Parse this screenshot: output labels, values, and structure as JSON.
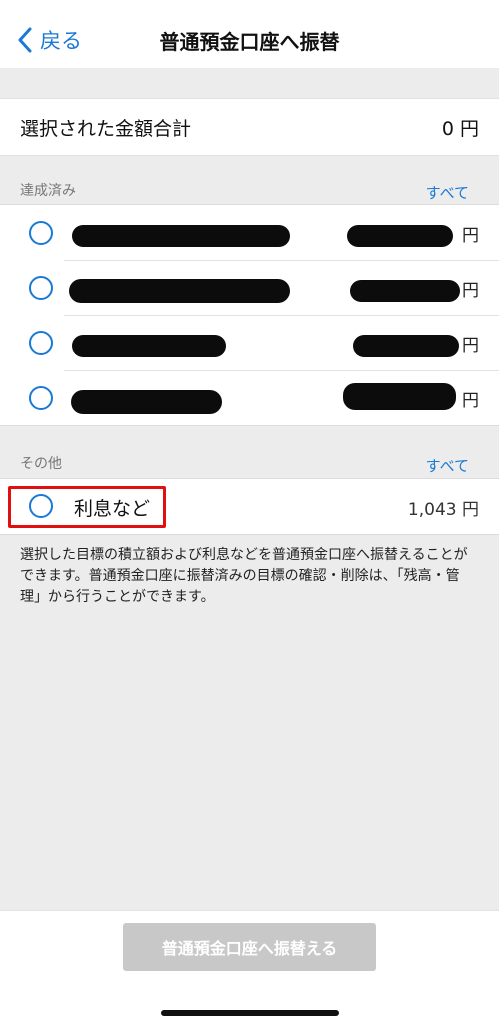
{
  "nav": {
    "back_label": "戻る",
    "title": "普通預金口座へ振替"
  },
  "total": {
    "label": "選択された金額合計",
    "value": "0 円"
  },
  "achieved": {
    "title": "達成済み",
    "all_label": "すべて",
    "rows": [
      {
        "yen": "円"
      },
      {
        "yen": "円"
      },
      {
        "yen": "円"
      },
      {
        "yen": "円"
      }
    ]
  },
  "other": {
    "title": "その他",
    "all_label": "すべて",
    "rows": [
      {
        "label": "利息など",
        "amount": "1,043 円"
      }
    ]
  },
  "note": "選択した目標の積立額および利息などを普通預金口座へ振替えることができます。普通預金口座に振替済みの目標の確認・削除は、「残高・管理」から行うことができます。",
  "footer": {
    "submit_label": "普通預金口座へ振替える"
  },
  "colors": {
    "accent": "#1a79d6",
    "highlight": "#e01010",
    "disabled_button": "#c8c8c8"
  }
}
